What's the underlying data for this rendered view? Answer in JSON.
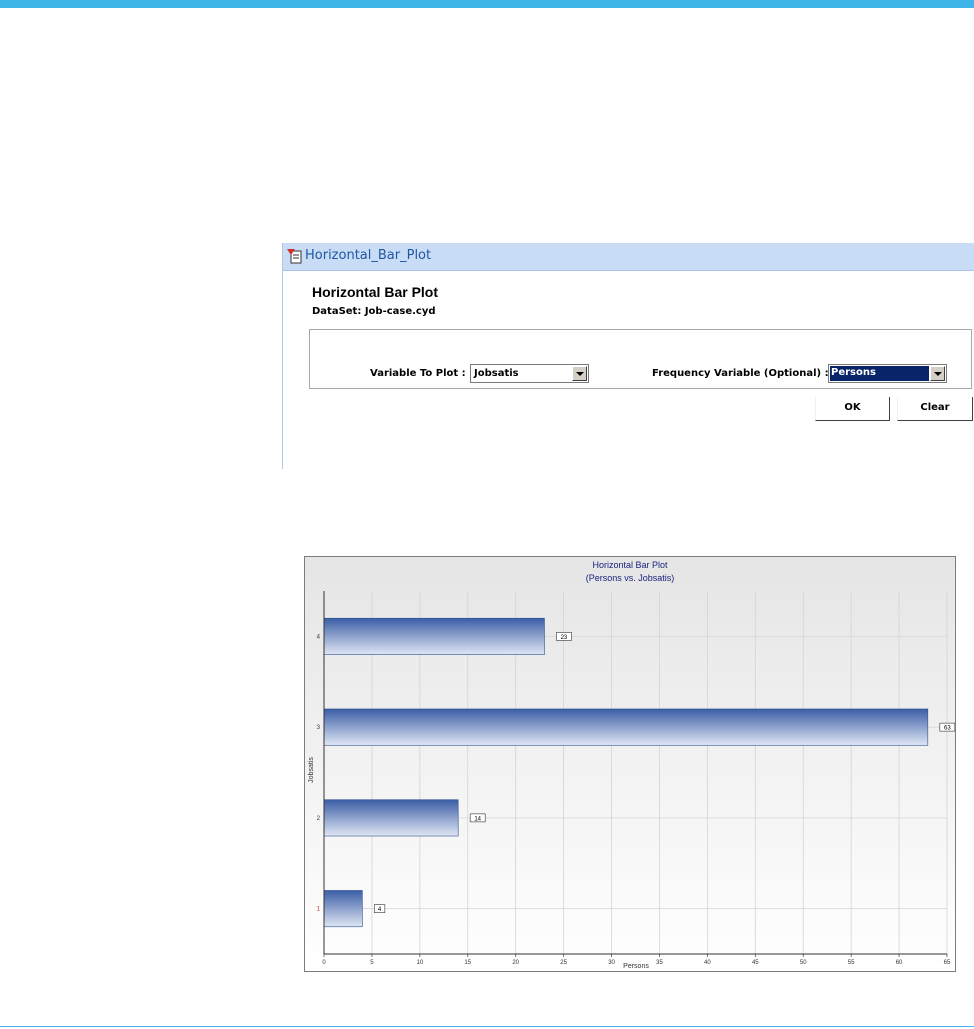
{
  "dialog": {
    "title": "Horizontal_Bar_Plot",
    "heading": "Horizontal Bar Plot",
    "dataset": "DataSet: Job-case.cyd",
    "variable_label": "Variable To Plot :",
    "variable_value": "Jobsatis",
    "frequency_label": "Frequency Variable (Optional) :",
    "frequency_value": "Persons",
    "ok_label": "OK",
    "clear_label": "Clear"
  },
  "colors": {
    "bar_dark": "#3b5ea6",
    "bar_light": "#dfe6f4",
    "title_text": "#1a237e",
    "accent": "#3fb5ea"
  },
  "chart_data": {
    "type": "bar",
    "orientation": "horizontal",
    "title": "Horizontal Bar Plot",
    "subtitle": "(Persons vs. Jobsatis)",
    "xlabel": "Persons",
    "ylabel": "Jobsatis",
    "categories": [
      "1",
      "2",
      "3",
      "4"
    ],
    "values": [
      4,
      14,
      63,
      23
    ],
    "data_labels": [
      "4",
      "14",
      "63",
      "23"
    ],
    "xlim": [
      0,
      65
    ],
    "x_ticks": [
      "0",
      "5",
      "10",
      "15",
      "20",
      "25",
      "30",
      "35",
      "40",
      "45",
      "50",
      "55",
      "60",
      "65"
    ],
    "grid": true
  }
}
